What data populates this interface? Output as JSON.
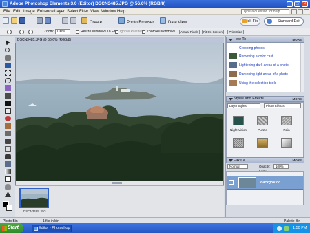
{
  "window": {
    "title": "Adobe Photoshop Elements 3.0 (Editor) DSCN3485.JPG @ 56.6% (RGB/8)"
  },
  "menu": {
    "items": [
      "File",
      "Edit",
      "Image",
      "Enhance",
      "Layer",
      "Select",
      "Filter",
      "View",
      "Window",
      "Help"
    ],
    "help_placeholder": "Type a question for help"
  },
  "shortcuts": {
    "create": "Create",
    "photo_browser": "Photo Browser",
    "date_view": "Date View",
    "quick_fix": "Quick Fix",
    "standard_edit": "Standard Edit"
  },
  "options": {
    "zoom_label": "Zoom:",
    "zoom_value": "100%",
    "resize_windows": "Resize Windows To Fit",
    "ignore_palettes": "Ignore Palettes",
    "zoom_all": "Zoom All Windows",
    "actual_pixels": "Actual Pixels",
    "fit_on_screen": "Fit On Screen",
    "print_size": "Print Size"
  },
  "document": {
    "title": "DSCN3485.JPG @ 56.6% (RGB/8)"
  },
  "photobin": {
    "thumb_caption": "DSCN3485.JPG"
  },
  "palettes": {
    "how_to": {
      "title": "How To",
      "more": "MORE",
      "items": [
        "Cropping photos",
        "Removing a color cast",
        "Lightening dark areas of a photo",
        "Darkening light areas of a photo",
        "Using the selection tools"
      ]
    },
    "styles": {
      "title": "Styles and Effects",
      "more": "MORE",
      "category": "Layer Styles",
      "library": "Photo Effects",
      "labels": [
        "Night Vision",
        "Puzzle",
        "Rain"
      ]
    },
    "layers": {
      "title": "Layers",
      "more": "MORE",
      "blend": "Normal",
      "opacity_label": "Opacity:",
      "opacity_value": "100%",
      "lock_label": "Lock:",
      "layer_name": "Background"
    }
  },
  "status": {
    "photo_bin": "Photo Bin",
    "count": "1 file in bin",
    "palette_bin": "Palette Bin"
  },
  "taskbar": {
    "start": "Start",
    "item": "Editor - Photoshop El...",
    "clock": "1:50 PM"
  },
  "colors": {
    "accent": "#2e62c8",
    "title_blue": "#1f4fc2",
    "link_blue": "#1a3bb8",
    "layer_sel": "#7a9fd1"
  }
}
